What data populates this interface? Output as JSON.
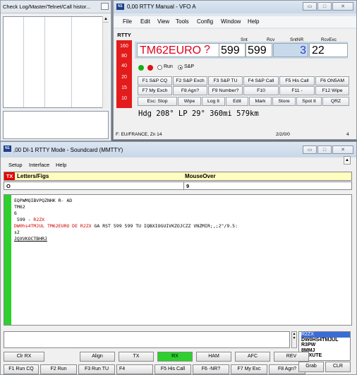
{
  "checklog": {
    "title": "Check Log/Master/Telnet/Call histor..."
  },
  "rtty": {
    "title": "0,00 RTTY Manual - VFO A",
    "menu": [
      "File",
      "Edit",
      "View",
      "Tools",
      "Config",
      "Window",
      "Help"
    ],
    "mode_label": "RTTY",
    "red_values": [
      "160",
      "80",
      "40",
      "20",
      "15",
      "10"
    ],
    "labels": {
      "snt": "Snt",
      "rcv": "Rcv",
      "sntnr": "SntNR",
      "rcvexc": "RcvExc"
    },
    "callsign": "TM62EURO",
    "question": "?",
    "snt": "599",
    "rcv": "599",
    "sntnr": "3",
    "rcvexc": "22",
    "run_label": "Run",
    "sp_label": "S&P",
    "fkeys_row1": [
      "F1 S&P CQ",
      "F2 S&P Exch",
      "F3 S&P TU",
      "F4 S&P Call",
      "F5 His Call",
      "F6 ON5AM"
    ],
    "fkeys_row2": [
      "F7 My Exch",
      "F8 Agn?",
      "F9 Number?",
      "F10",
      "F11 -",
      "F12 Wipe"
    ],
    "fkeys_row3": [
      "Esc: Stop",
      "Wipe",
      "Log It",
      "Edit",
      "Mark",
      "Store",
      "Spot It",
      "QRZ"
    ],
    "bearing": "Hdg 208° LP 29° 360mi 579km",
    "status_left": "F: EU/FRANCE, Zn 14",
    "status_mid": "2/2/0/0",
    "status_right": "4"
  },
  "di": {
    "title": ",00  DI-1 RTTY Mode - Soundcard (MMTTY)",
    "menu": [
      "Setup",
      "Interface",
      "Help"
    ],
    "tx_label": "TX",
    "letters_figs": "Letters/Figs",
    "mouseover": "MouseOver",
    "val_left": "O",
    "val_right": "9",
    "rx_lines": [
      {
        "t": "EQPWMQIBVPQZNHK R- AD",
        "c": ""
      },
      {
        "t": "TM62",
        "c": ""
      },
      {
        "t": "6",
        "c": ""
      },
      {
        "t": " 599 - ",
        "c": "",
        "tail": "R2ZX",
        "tailc": "red"
      },
      {
        "t": "",
        "c": "mixed"
      },
      {
        "t": "s2",
        "c": ""
      },
      {
        "t": "JQXVKOCTBHRJ",
        "c": "u"
      }
    ],
    "rx_line5_a": "DW0hs4TMJUL TM62EURO DE R2ZX",
    "rx_line5_b": " GA RST 599 599 TU IQBXIOGUIVKZOJCZZ VNZMIR;,;2\"/9.5:",
    "callstack": [
      "R2ZX",
      "DW0HS4TMJUL",
      "R3PW",
      "8MMJ",
      "DOXUTE"
    ],
    "buttons": [
      "Clr RX",
      "Align",
      "TX",
      "RX",
      "HAM",
      "AFC",
      "REV"
    ],
    "fkeys": [
      "F1 Run CQ",
      "F2 Run",
      "F3 Run TU",
      "F4",
      "F5 His Call",
      "F6 -NR?",
      "F7 My Exc",
      "F8 Agn?"
    ],
    "grab": "Grab",
    "clr": "CLR"
  }
}
